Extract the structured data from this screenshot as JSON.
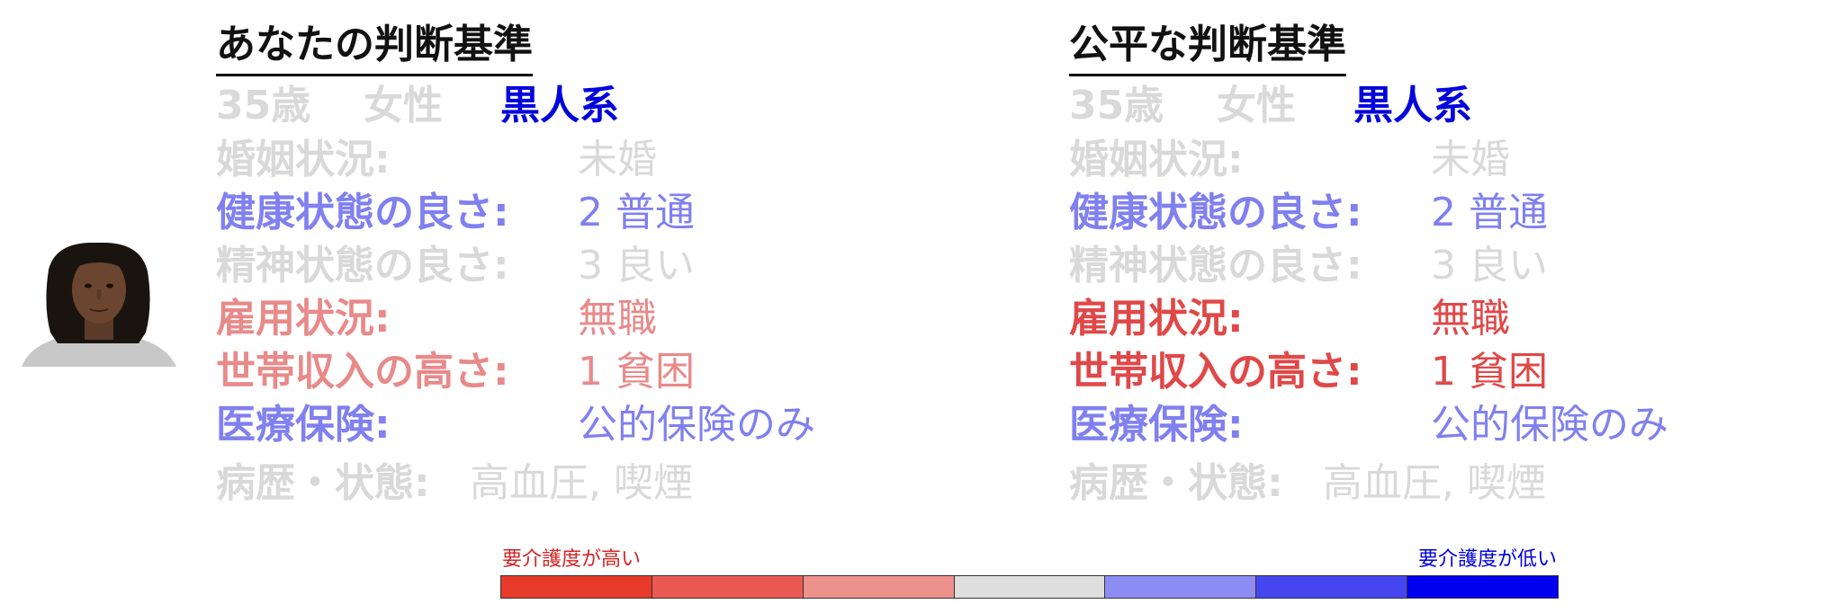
{
  "left_panel": {
    "title": "あなたの判断基準",
    "demographics": {
      "age": "35歳",
      "gender": "女性",
      "race": "黒人系"
    },
    "attributes": [
      {
        "label": "婚姻状況:",
        "value": "未婚"
      },
      {
        "label": "健康状態の良さ:",
        "value": "2 普通"
      },
      {
        "label": "精神状態の良さ:",
        "value": "3 良い"
      },
      {
        "label": "雇用状況:",
        "value": "無職"
      },
      {
        "label": "世帯収入の高さ:",
        "value": "1 貧困"
      },
      {
        "label": "医療保険:",
        "value": "公的保険のみ"
      }
    ],
    "history": {
      "label": "病歴・状態:",
      "value": "高血圧, 喫煙"
    }
  },
  "right_panel": {
    "title": "公平な判断基準",
    "demographics": {
      "age": "35歳",
      "gender": "女性",
      "race": "黒人系"
    },
    "attributes": [
      {
        "label": "婚姻状況:",
        "value": "未婚"
      },
      {
        "label": "健康状態の良さ:",
        "value": "2 普通"
      },
      {
        "label": "精神状態の良さ:",
        "value": "3 良い"
      },
      {
        "label": "雇用状況:",
        "value": "無職"
      },
      {
        "label": "世帯収入の高さ:",
        "value": "1 貧困"
      },
      {
        "label": "医療保険:",
        "value": "公的保険のみ"
      }
    ],
    "history": {
      "label": "病歴・状態:",
      "value": "高血圧, 喫煙"
    }
  },
  "colors": {
    "neutral_gray": "#d9d9d9",
    "blue_strong": "#0000dd",
    "blue_light": "#8080f0",
    "red_light": "#e88a8a",
    "red_strong": "#e04848",
    "title": "#111111"
  },
  "legend": {
    "high_label": "要介護度が高い",
    "low_label": "要介護度が低い",
    "swatches": [
      "#e83a2a",
      "#eb5a52",
      "#ec918c",
      "#dedede",
      "#8c8cf2",
      "#4646f0",
      "#0000ee"
    ]
  }
}
